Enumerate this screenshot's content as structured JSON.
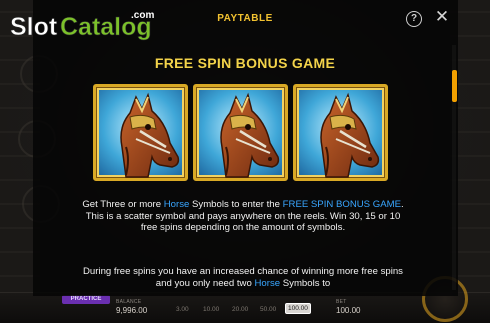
{
  "watermark": {
    "brand": "SlotCatalog",
    "suffix": ".com"
  },
  "paytable": {
    "header_title": "PAYTABLE",
    "help_icon": "?",
    "close_icon": "✕",
    "section_title": "FREE SPIN BONUS GAME",
    "symbol_count": 3,
    "symbol_icon": "horse-symbol",
    "desc1": {
      "p1": "Get Three or more ",
      "h1": "Horse",
      "p2": " Symbols to enter the ",
      "h2": "FREE SPIN BONUS GAME",
      "p3": ". This is a scatter symbol and pays anywhere on the reels. Win 30, 15 or 10 free spins depending on the amount of symbols."
    },
    "desc2": {
      "p1": "During free spins you have an increased chance of winning more free spins and you only need two ",
      "h1": "Horse",
      "p2": " Symbols to"
    }
  },
  "bottom_bar": {
    "practice_label": "PRACTICE",
    "balance_label": "BALANCE",
    "balance_value": "9,996.00",
    "bets": [
      "3.00",
      "10.00",
      "20.00",
      "50.00",
      "100.00"
    ],
    "active_bet": "100.00",
    "bet_label": "BET",
    "bet_value": "100.00"
  },
  "colors": {
    "accent": "#f2c230",
    "highlight": "#39a6ff",
    "scroll": "#f2a000",
    "practice": "#6a2fb0"
  }
}
